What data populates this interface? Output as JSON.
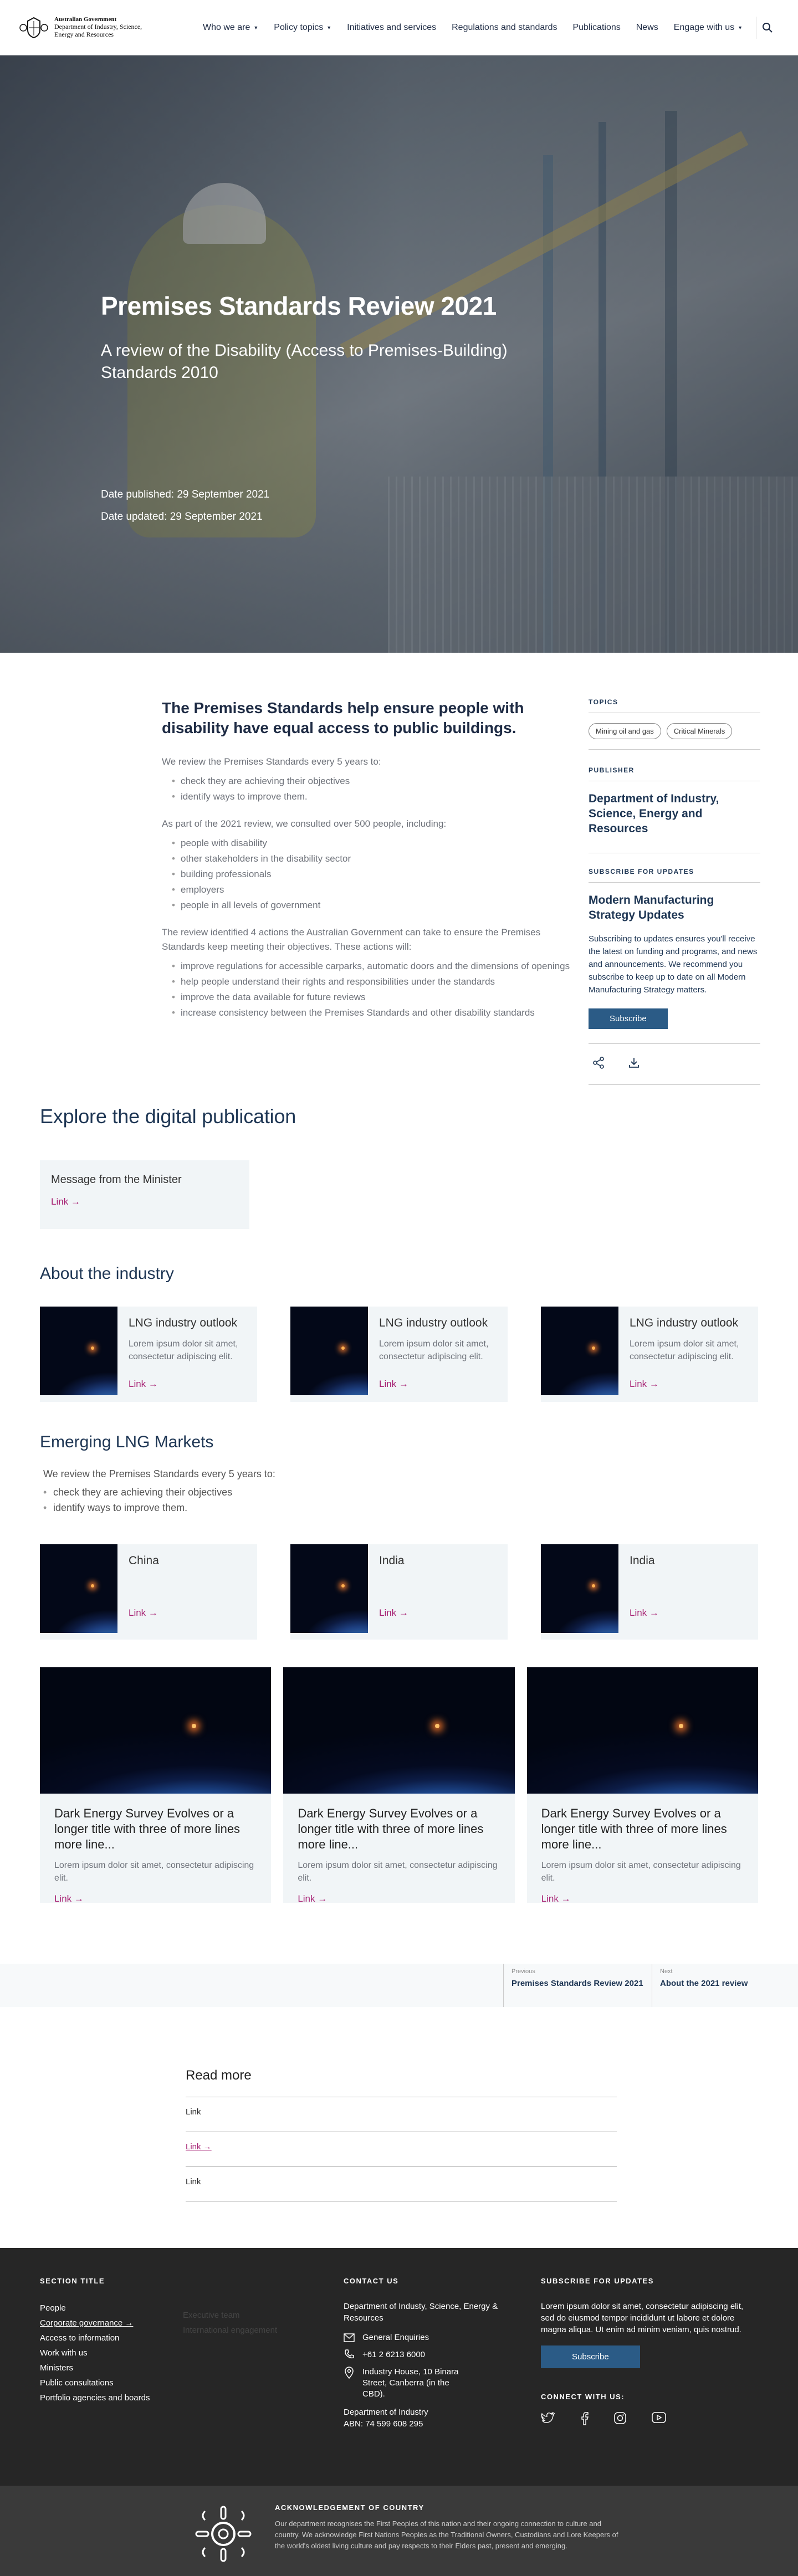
{
  "header": {
    "gov_line1": "Australian Government",
    "gov_line2": "Department of Industry, Science,",
    "gov_line3": "Energy and Resources",
    "nav": [
      {
        "label": "Who we are",
        "dropdown": true
      },
      {
        "label": "Policy topics",
        "dropdown": true
      },
      {
        "label": "Initiatives and services",
        "dropdown": false
      },
      {
        "label": "Regulations and standards",
        "dropdown": false
      },
      {
        "label": "Publications",
        "dropdown": false
      },
      {
        "label": "News",
        "dropdown": false
      },
      {
        "label": "Engage with us",
        "dropdown": true
      }
    ]
  },
  "hero": {
    "title": "Premises Standards Review 2021",
    "subtitle": "A review of the Disability (Access to Premises-Building) Standards 2010",
    "date_published": "Date published: 29 September 2021",
    "date_updated": "Date updated: 29 September 2021"
  },
  "article": {
    "heading": "The Premises Standards help ensure people with disability have equal access to public buildings.",
    "p1": "We review the Premises Standards every 5 years to:",
    "list1": [
      "check they are achieving their objectives",
      "identify ways to improve them."
    ],
    "p2": "As part of the 2021 review, we consulted over 500 people, including:",
    "list2": [
      "people with disability",
      "other stakeholders in the disability sector",
      "building professionals",
      "employers",
      "people in all levels of government"
    ],
    "p3": "The review identified 4 actions the Australian Government can take to ensure the Premises Standards keep meeting their objectives. These actions will:",
    "list3": [
      "improve regulations for accessible carparks, automatic doors and the dimensions of openings",
      "help people understand their rights and responsibilities under the standards",
      "improve the data available for future reviews",
      "increase consistency between the Premises Standards and other disability standards"
    ]
  },
  "aside": {
    "topics_heading": "TOPICS",
    "tags": [
      "Mining oil and gas",
      "Critical Minerals"
    ],
    "publisher_heading": "PUBLISHER",
    "publisher": "Department of Industry, Science, Energy and Resources",
    "subscribe_heading": "SUBSCRIBE FOR UPDATES",
    "subscribe_title": "Modern Manufacturing Strategy Updates",
    "subscribe_desc": "Subscribing to updates ensures you'll receive the latest on funding and programs, and news and announcements. We recommend you subscribe to keep up to date on all Modern Manufacturing Strategy matters.",
    "subscribe_button": "Subscribe"
  },
  "explore": {
    "title": "Explore the digital publication",
    "minister_title": "Message from the Minister",
    "minister_link": "Link →"
  },
  "industry": {
    "title": "About the industry",
    "cards": [
      {
        "title": "LNG industry outlook",
        "desc": "Lorem ipsum dolor sit amet, consectetur adipiscing elit.",
        "link": "Link →"
      },
      {
        "title": "LNG industry outlook",
        "desc": "Lorem ipsum dolor sit amet, consectetur adipiscing elit.",
        "link": "Link →"
      },
      {
        "title": "LNG industry outlook",
        "desc": "Lorem ipsum dolor sit amet, consectetur adipiscing elit.",
        "link": "Link →"
      }
    ]
  },
  "markets": {
    "title": "Emerging LNG Markets",
    "intro": "We review the Premises Standards every 5 years to:",
    "list": [
      "check they are achieving their objectives",
      "identify ways to improve them."
    ],
    "cards": [
      {
        "title": "China",
        "link": "Link →"
      },
      {
        "title": "India",
        "link": "Link →"
      },
      {
        "title": "India",
        "link": "Link →"
      }
    ],
    "big_cards": [
      {
        "title": "Dark Energy Survey Evolves or a longer title with three of more lines more line...",
        "desc": "Lorem ipsum dolor sit amet, consectetur adipiscing elit.",
        "link": "Link →"
      },
      {
        "title": "Dark Energy Survey Evolves or a longer title with three of more lines more line...",
        "desc": "Lorem ipsum dolor sit amet, consectetur adipiscing elit.",
        "link": "Link →"
      },
      {
        "title": "Dark Energy Survey Evolves or a longer title with three of more lines more line...",
        "desc": "Lorem ipsum dolor sit amet, consectetur adipiscing elit.",
        "link": "Link →"
      }
    ]
  },
  "pager": {
    "prev_label": "Previous",
    "prev_title": "Premises Standards Review 2021",
    "next_label": "Next",
    "next_title": "About the 2021 review"
  },
  "read_more": {
    "title": "Read more",
    "items": [
      "Link",
      "Link →",
      "Link"
    ]
  },
  "footer": {
    "section_title": "SECTION TITLE",
    "links": [
      "People",
      "Corporate governance →",
      "Access to information",
      "Work with us",
      "Ministers",
      "Public consultations",
      "Portfolio agencies and boards"
    ],
    "faded_links": [
      "Executive team",
      "International engagement"
    ],
    "contact_heading": "CONTACT US",
    "contact_org": "Department of Industy, Science, Energy & Resources",
    "contact_email": "General Enquiries",
    "contact_phone": "+61 2 6213 6000",
    "contact_address": "Industry House, 10 Binara Street, Canberra (in the CBD).",
    "contact_dept": "Department of Industry",
    "contact_abn": "ABN: 74 599 608 295",
    "subscribe_heading": "SUBSCRIBE FOR UPDATES",
    "subscribe_text": "Lorem ipsum dolor sit amet, consectetur adipiscing elit, sed do eiusmod tempor incididunt ut labore et dolore magna aliqua. Ut enim ad minim veniam, quis nostrud.",
    "subscribe_button": "Subscribe",
    "connect_heading": "CONNECT WITH US:",
    "social_icons": [
      "twitter-icon",
      "facebook-icon",
      "instagram-icon",
      "youtube-icon"
    ]
  },
  "acknowledgement": {
    "title": "ACKNOWLEDGEMENT OF COUNTRY",
    "text": "Our department recognises the First Peoples of this nation and their ongoing connection to culture and country. We acknowledge First Nations Peoples as the Traditional Owners, Custodians and Lore Keepers of the world's oldest living culture and pay respects to their Elders past, present and emerging."
  },
  "colors": {
    "navy": "#1e3654",
    "link_magenta": "#a62173",
    "button_blue": "#2b5b86",
    "footer_bg": "#262626"
  }
}
